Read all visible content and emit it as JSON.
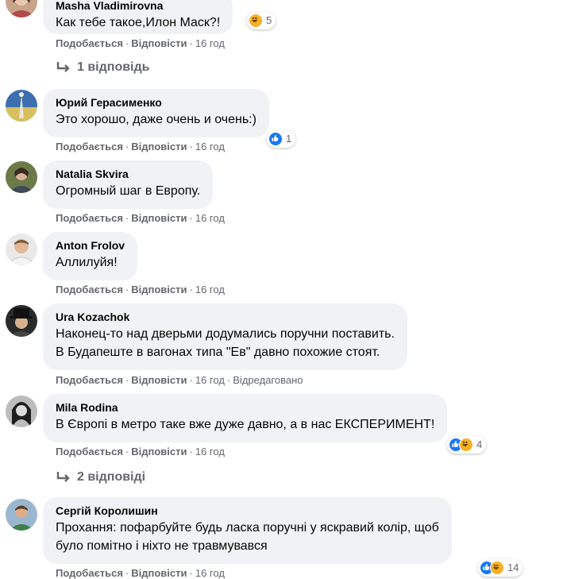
{
  "labels": {
    "like": "Подобається",
    "reply": "Відповісти",
    "sep": "·"
  },
  "colors": {
    "bubble": "#f0f2f5",
    "secondary_text": "#65676b",
    "like_blue": "#1877f2",
    "haha_yellow": "#f7b125"
  },
  "comments": [
    {
      "author": "Masha Vladimirovna",
      "text": [
        "Как тебе такое,Илон Маск?!"
      ],
      "time": "16 год",
      "reactions": {
        "icons": [
          "haha-icon"
        ],
        "count": "5"
      },
      "replies": "1 відповідь"
    },
    {
      "author": "Юрий Герасименко",
      "text": [
        "Это хорошо, даже очень и очень:)"
      ],
      "time": "16 год",
      "reactions": {
        "icons": [
          "like-icon"
        ],
        "count": "1"
      }
    },
    {
      "author": "Natalia Skvira",
      "text": [
        "Огромный шаг в Европу."
      ],
      "time": "16 год"
    },
    {
      "author": "Anton Frolov",
      "text": [
        "Аллилуйя!"
      ],
      "time": "16 год"
    },
    {
      "author": "Ura Kozachok",
      "text": [
        "Наконец-то над дверьми додумались поручни поставить.",
        "В Будапеште в вагонах типа \"Ев\" давно похожие стоят."
      ],
      "time": "16 год",
      "edited": "Відредаговано"
    },
    {
      "author": "Mila Rodina",
      "text": [
        "В Європі в метро таке вже дуже давно, а в нас ЕКСПЕРИМЕНТ!"
      ],
      "time": "16 год",
      "reactions": {
        "icons": [
          "like-icon",
          "haha-icon"
        ],
        "count": "4"
      },
      "replies": "2 відповіді"
    },
    {
      "author": "Сергій Королишин",
      "text": [
        "Прохання: пофарбуйте будь ласка поручні у яскравий колір, щоб",
        "було помітно і ніхто не травмувався"
      ],
      "time": "16 год",
      "reactions": {
        "icons": [
          "like-icon",
          "haha-icon"
        ],
        "count": "14"
      }
    }
  ]
}
